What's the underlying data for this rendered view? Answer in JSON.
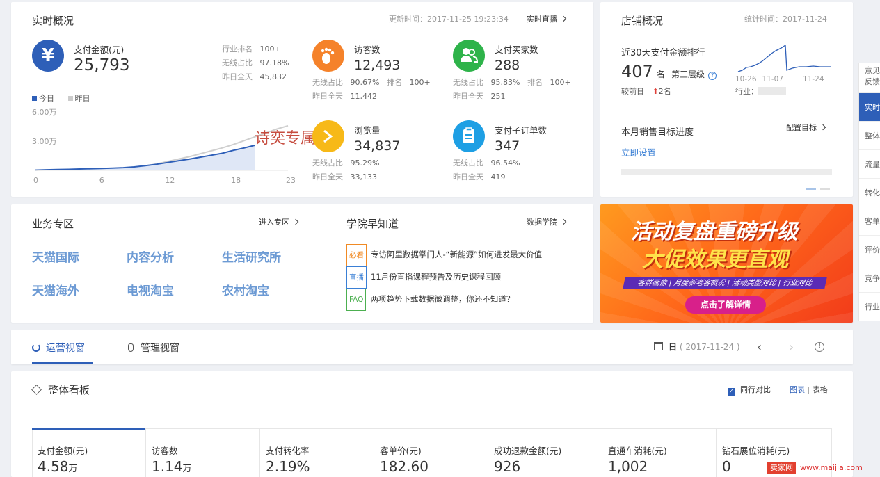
{
  "realtime": {
    "title": "实时概况",
    "update_time": "更新时间：2017-11-25 19:23:34",
    "live_link": "实时直播",
    "pay": {
      "label": "支付金额(元)",
      "value": "25,793",
      "rank_label": "行业排名",
      "rank": "100+",
      "wireless_label": "无线占比",
      "wireless": "97.18%",
      "yesterday_label": "昨日全天",
      "yesterday": "45,832"
    },
    "legend": {
      "today": "今日",
      "yesterday": "昨日"
    },
    "yticks": [
      "6.00万",
      "3.00万"
    ],
    "xticks": [
      "0",
      "6",
      "12",
      "18",
      "23"
    ],
    "watermark": "诗奕专属",
    "visitors": {
      "label": "访客数",
      "value": "12,493",
      "wireless_label": "无线占比",
      "wireless": "90.67%",
      "rank_label": "排名",
      "rank": "100+",
      "yesterday_label": "昨日全天",
      "yesterday": "11,442"
    },
    "buyers": {
      "label": "支付买家数",
      "value": "288",
      "wireless_label": "无线占比",
      "wireless": "95.83%",
      "rank_label": "排名",
      "rank": "100+",
      "yesterday_label": "昨日全天",
      "yesterday": "251"
    },
    "pageviews": {
      "label": "浏览量",
      "value": "34,837",
      "wireless_label": "无线占比",
      "wireless": "95.29%",
      "yesterday_label": "昨日全天",
      "yesterday": "33,133"
    },
    "suborders": {
      "label": "支付子订单数",
      "value": "347",
      "wireless_label": "无线占比",
      "wireless": "96.54%",
      "yesterday_label": "昨日全天",
      "yesterday": "419"
    }
  },
  "chart_data": {
    "type": "area",
    "x": [
      0,
      1,
      2,
      3,
      4,
      5,
      6,
      7,
      8,
      9,
      10,
      11,
      12,
      13,
      14,
      15,
      16,
      17,
      18,
      19,
      20,
      21,
      22,
      23
    ],
    "ylim": [
      0,
      60000
    ],
    "yticks": [
      "6.00万",
      "3.00万"
    ],
    "series": [
      {
        "name": "今日",
        "color": "#2e5fb8",
        "values": [
          300,
          600,
          900,
          1100,
          1400,
          1700,
          2000,
          2300,
          2800,
          3600,
          4800,
          6200,
          8000,
          9800,
          11500,
          13500,
          15500,
          17500,
          20500,
          23000,
          25793
        ]
      },
      {
        "name": "昨日",
        "color": "#cfcfcf",
        "values": [
          200,
          400,
          600,
          800,
          1000,
          1200,
          1400,
          1700,
          2200,
          3200,
          4600,
          6500,
          9000,
          11500,
          14000,
          17000,
          20000,
          23000,
          26500,
          30500,
          34500,
          38500,
          42500,
          45832
        ]
      }
    ]
  },
  "shop": {
    "title": "店铺概况",
    "stat_time": "统计时间：2017-11-24",
    "rank_title": "近30天支付金额排行",
    "rank_value": "407",
    "rank_unit": "名",
    "level": "第三层级",
    "compare_label": "较前日",
    "compare_value": "2名",
    "spark_labels": [
      "10-26",
      "11-07",
      "11-24"
    ],
    "industry_label": "行业：",
    "target_title": "本月销售目标进度",
    "config_link": "配置目标",
    "set_now": "立即设置"
  },
  "business": {
    "title": "业务专区",
    "enter_link": "进入专区",
    "items": [
      "天猫国际",
      "内容分析",
      "生活研究所",
      "天猫海外",
      "电视淘宝",
      "农村淘宝"
    ]
  },
  "academy": {
    "title": "学院早知道",
    "link": "数据学院",
    "news": [
      {
        "tag": "必看",
        "color": "#f08a24",
        "text": "专访阿里数据掌门人-“新能源”如何进发最大价值"
      },
      {
        "tag": "直播",
        "color": "#3a7fd5",
        "text": "11月份直播课程预告及历史课程回顾"
      },
      {
        "tag": "FAQ",
        "color": "#4caf50",
        "text": "两项趋势下载数据微调整，你还不知道？"
      }
    ]
  },
  "banner": {
    "line1": "活动复盘重磅升级",
    "line2": "大促效果更直观",
    "sub": "客群画像 | 月度新老客概况 | 活动类型对比 | 行业对比",
    "button": "点击了解详情"
  },
  "tabs": {
    "operation": "运营视窗",
    "management": "管理视窗",
    "date_prefix": "日",
    "date": "( 2017-11-24 )"
  },
  "board": {
    "title": "整体看板",
    "compare": "同行对比",
    "view_chart": "图表",
    "view_table": "表格",
    "metrics": [
      {
        "name": "支付金额(元)",
        "value": "4.58",
        "unit": "万"
      },
      {
        "name": "访客数",
        "value": "1.14",
        "unit": "万"
      },
      {
        "name": "支付转化率",
        "value": "2.19%",
        "unit": ""
      },
      {
        "name": "客单价(元)",
        "value": "182.60",
        "unit": ""
      },
      {
        "name": "成功退款金额(元)",
        "value": "926",
        "unit": ""
      },
      {
        "name": "直通车消耗(元)",
        "value": "1,002",
        "unit": ""
      },
      {
        "name": "钻石展位消耗(元)",
        "value": "0",
        "unit": ""
      }
    ]
  },
  "sidebar": [
    "意见反馈",
    "实时",
    "整体",
    "流量",
    "转化",
    "客单",
    "评价",
    "竞争",
    "行业"
  ],
  "watermark_site": {
    "brand": "卖家网",
    "url": "www.maijia.com"
  }
}
